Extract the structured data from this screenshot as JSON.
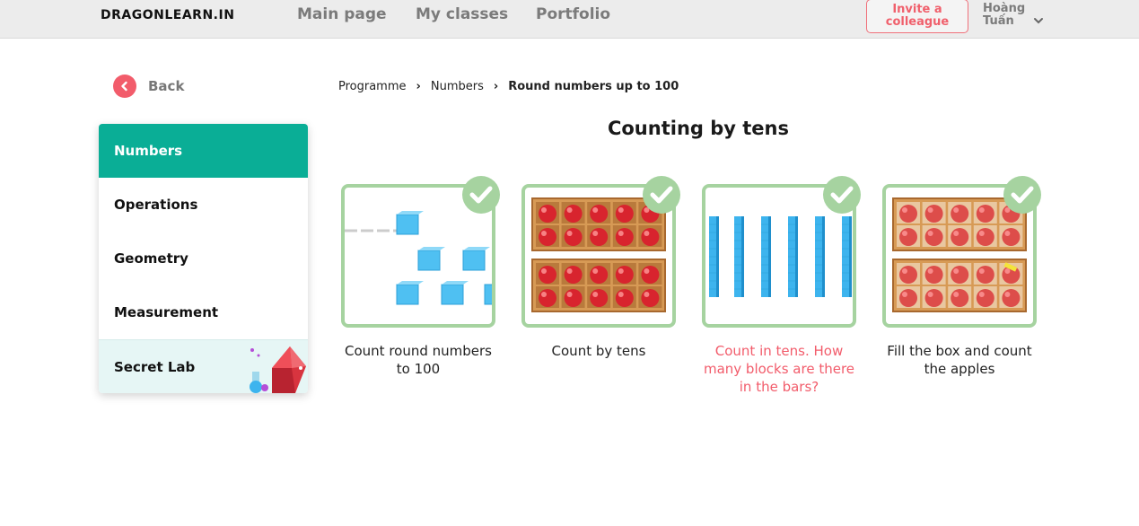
{
  "header": {
    "logo": "DRAGONLEARN.IN",
    "nav": [
      "Main page",
      "My classes",
      "Portfolio"
    ],
    "invite_line1": "Invite a",
    "invite_line2": "colleague",
    "user_first": "Hoàng",
    "user_last": "Tuấn"
  },
  "back_label": "Back",
  "sidebar": {
    "items": [
      {
        "label": "Numbers",
        "active": true
      },
      {
        "label": "Operations"
      },
      {
        "label": "Geometry"
      },
      {
        "label": "Measurement"
      },
      {
        "label": "Secret Lab"
      }
    ]
  },
  "breadcrumb": [
    "Programme",
    "Numbers",
    "Round numbers up to 100"
  ],
  "page_title": "Counting by tens",
  "cards": [
    {
      "label": "Count round numbers to 100",
      "completed": true
    },
    {
      "label": "Count by tens",
      "completed": true
    },
    {
      "label": "Count in tens. How many blocks are there in the bars?",
      "completed": true,
      "highlight": true
    },
    {
      "label": "Fill the box and count the apples",
      "completed": true
    }
  ],
  "colors": {
    "accent": "#0aae96",
    "brand_red": "#f25c6b",
    "completed_border": "#a6d3a0",
    "block_blue": "#3db4ee",
    "apple_red": "#d8242e",
    "crate": "#d79a55"
  },
  "icons": [
    "chevron-left-icon",
    "chevron-down-icon",
    "check-icon",
    "crystal-icon",
    "flask-icon"
  ]
}
